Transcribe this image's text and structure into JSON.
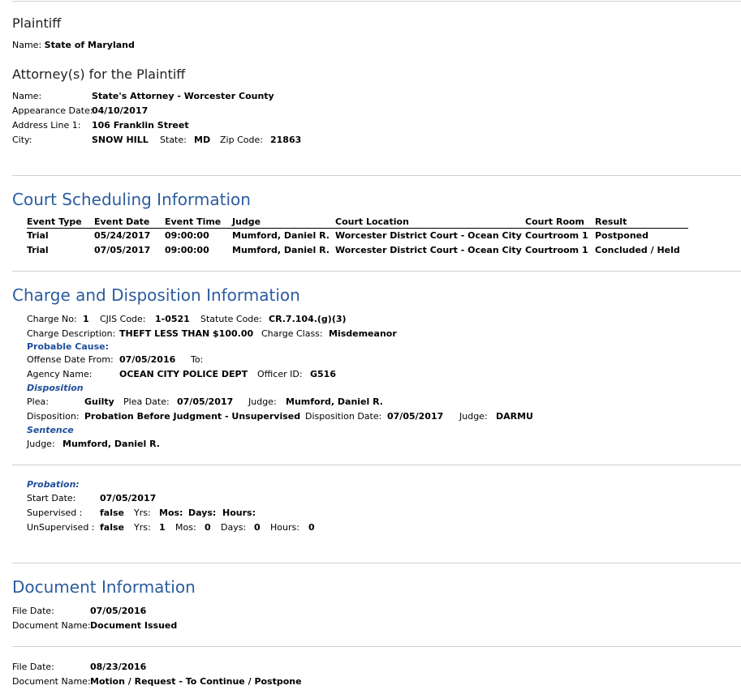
{
  "plaintiff": {
    "heading": "Plaintiff",
    "name_label": "Name:",
    "name_value": "State of Maryland"
  },
  "attorney": {
    "heading": "Attorney(s) for the Plaintiff",
    "name_label": "Name:",
    "name_value": "State's Attorney - Worcester County",
    "appearance_label": "Appearance Date:",
    "appearance_value": "04/10/2017",
    "address_label": "Address Line 1:",
    "address_value": "106 Franklin Street",
    "city_label": "City:",
    "city_value": "SNOW HILL",
    "state_label": "State:",
    "state_value": "MD",
    "zip_label": "Zip Code:",
    "zip_value": "21863"
  },
  "scheduling": {
    "heading": "Court Scheduling Information",
    "columns": [
      "Event Type",
      "Event Date",
      "Event Time",
      "Judge",
      "Court Location",
      "Court Room",
      "Result"
    ],
    "rows": [
      [
        "Trial",
        "05/24/2017",
        "09:00:00",
        "Mumford, Daniel R.",
        "Worcester District Court - Ocean City",
        "Courtroom 1",
        "Postponed"
      ],
      [
        "Trial",
        "07/05/2017",
        "09:00:00",
        "Mumford, Daniel R.",
        "Worcester District Court - Ocean City",
        "Courtroom 1",
        "Concluded / Held"
      ]
    ]
  },
  "charge": {
    "heading": "Charge and Disposition Information",
    "charge_no_label": "Charge No:",
    "charge_no_value": "1",
    "cjis_label": "CJIS Code:",
    "cjis_value": "1-0521",
    "statute_label": "Statute Code:",
    "statute_value": "CR.7.104.(g)(3)",
    "desc_label": "Charge Description:",
    "desc_value": "THEFT LESS THAN $100.00",
    "class_label": "Charge Class:",
    "class_value": "Misdemeanor",
    "probable_cause": "Probable Cause:",
    "offense_label": "Offense Date From:",
    "offense_value": "07/05/2016",
    "to_label": "To:",
    "agency_label": "Agency Name:",
    "agency_value": "OCEAN CITY POLICE DEPT",
    "officer_label": "Officer ID:",
    "officer_value": "G516",
    "disposition_heading": "Disposition",
    "plea_label": "Plea:",
    "plea_value": "Guilty",
    "plea_date_label": "Plea Date:",
    "plea_date_value": "07/05/2017",
    "judge_label": "Judge:",
    "plea_judge_value": "Mumford, Daniel R.",
    "disp_label": "Disposition:",
    "disp_value": "Probation Before Judgment - Unsupervised",
    "disp_date_label": "Disposition Date:",
    "disp_date_value": "07/05/2017",
    "disp_judge_value": "DARMU",
    "sentence_heading": "Sentence",
    "sentence_judge_value": "Mumford, Daniel R."
  },
  "probation": {
    "heading": "Probation:",
    "start_label": "Start Date:",
    "start_value": "07/05/2017",
    "supervised_label": "Supervised :",
    "supervised_value": "false",
    "unsupervised_label": "UnSupervised :",
    "unsupervised_value": "false",
    "yrs_label": "Yrs:",
    "mos_label": "Mos:",
    "days_label": "Days:",
    "hours_label": "Hours:",
    "u_yrs": "1",
    "u_mos": "0",
    "u_days": "0",
    "u_hours": "0"
  },
  "documents": {
    "heading": "Document Information",
    "file_date_label": "File Date:",
    "doc_name_label": "Document Name:",
    "items": [
      {
        "file_date": "07/05/2016",
        "name": "Document Issued"
      },
      {
        "file_date": "08/23/2016",
        "name": "Motion / Request - To Continue / Postpone"
      }
    ]
  }
}
